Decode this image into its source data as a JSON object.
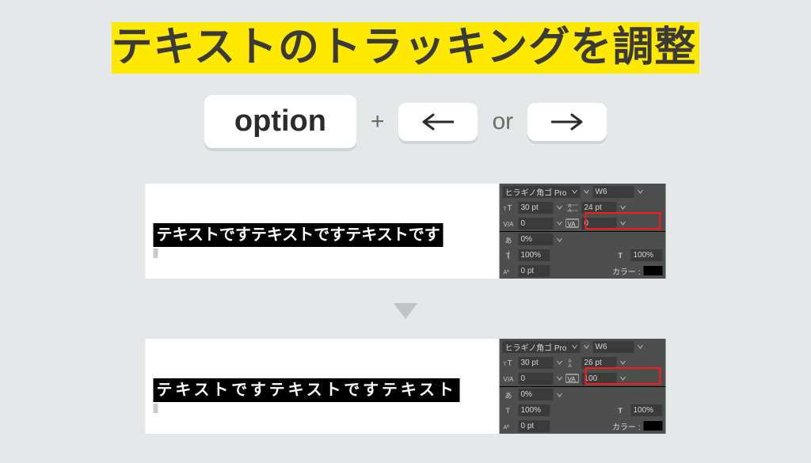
{
  "title": "テキストのトラッキングを調整",
  "keys": {
    "option": "option",
    "plus": "+",
    "or": "or"
  },
  "panel": {
    "font": "ヒラギノ角ゴ Pro",
    "weight": "W6",
    "vertScaleIcon": "100%",
    "horizScaleIcon": "100%",
    "shift": "0 pt",
    "colorLabel": "カラー :"
  },
  "example1": {
    "sample_text": "テキストですテキストですテキストです",
    "font_size": "30 pt",
    "leading": "24 pt",
    "kerning": "0",
    "tracking": "0",
    "vstretch": "0%"
  },
  "example2": {
    "sample_text": "テキストですテキストですテキスト",
    "font_size": "30 pt",
    "leading": "26 pt",
    "kerning": "0",
    "tracking": "100",
    "vstretch": "0%"
  }
}
